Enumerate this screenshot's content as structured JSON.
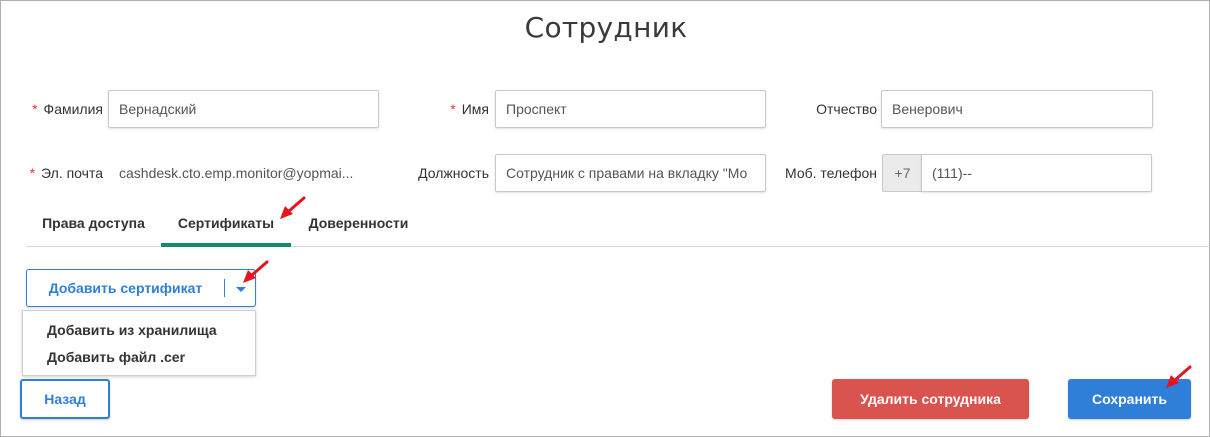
{
  "page": {
    "title": "Сотрудник"
  },
  "form": {
    "last_name": {
      "label": "Фамилия",
      "required_mark": "*",
      "value": "Вернадский"
    },
    "first_name": {
      "label": "Имя",
      "required_mark": "*",
      "value": "Проспект"
    },
    "middle_name": {
      "label": "Отчество",
      "value": "Венерович"
    },
    "email": {
      "label": "Эл. почта",
      "required_mark": "*",
      "value": "cashdesk.cto.emp.monitor@yopmai..."
    },
    "position": {
      "label": "Должность",
      "value": "Сотрудник с правами на вкладку \"Мо"
    },
    "phone": {
      "label": "Моб. телефон",
      "prefix": "+7",
      "value": "(111)--"
    }
  },
  "tabs": [
    {
      "label": "Права доступа",
      "active": false
    },
    {
      "label": "Сертификаты",
      "active": true
    },
    {
      "label": "Доверенности",
      "active": false
    }
  ],
  "certificates": {
    "add_button_label": "Добавить сертификат",
    "dropdown_items": [
      "Добавить из хранилища",
      "Добавить файл .cer"
    ]
  },
  "actions": {
    "back_label": "Назад",
    "delete_label": "Удалить сотрудника",
    "save_label": "Сохранить"
  },
  "colors": {
    "accent_blue": "#2f7ed8",
    "danger_red": "#d9534f",
    "active_tab_underline": "#138a6a",
    "annotation_arrow": "#e8141c"
  },
  "icons": {
    "dropdown_caret": "chevron-down-icon",
    "annotation": "red-pointer-arrow-icon"
  }
}
